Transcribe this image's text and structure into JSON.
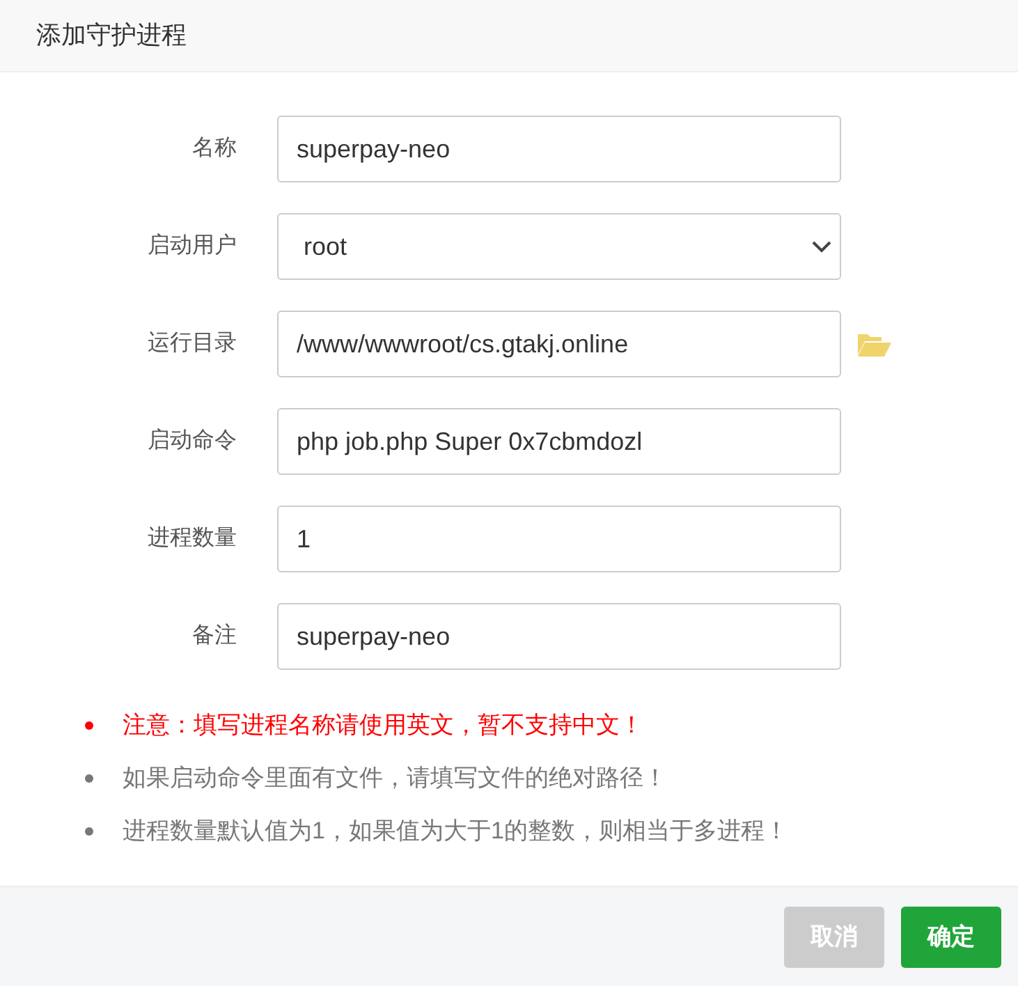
{
  "dialog": {
    "title": "添加守护进程"
  },
  "fields": [
    {
      "label": "名称",
      "kind": "text",
      "value": "superpay-neo"
    },
    {
      "label": "启动用户",
      "kind": "select",
      "value": "root"
    },
    {
      "label": "运行目录",
      "kind": "folder",
      "value": "/www/wwwroot/cs.gtakj.online"
    },
    {
      "label": "启动命令",
      "kind": "text",
      "value": "php job.php Super 0x7cbmdozl"
    },
    {
      "label": "进程数量",
      "kind": "text",
      "value": "1"
    },
    {
      "label": "备注",
      "kind": "text",
      "value": "superpay-neo"
    }
  ],
  "notes": [
    {
      "text": "注意：填写进程名称请使用英文，暂不支持中文！",
      "color": "#ff0000"
    },
    {
      "text": "如果启动命令里面有文件，请填写文件的绝对路径！",
      "color": "#777777"
    },
    {
      "text": "进程数量默认值为1，如果值为大于1的整数，则相当于多进程！",
      "color": "#777777"
    }
  ],
  "buttons": [
    {
      "label": "取消",
      "kind": "cancel"
    },
    {
      "label": "确定",
      "kind": "primary"
    }
  ]
}
